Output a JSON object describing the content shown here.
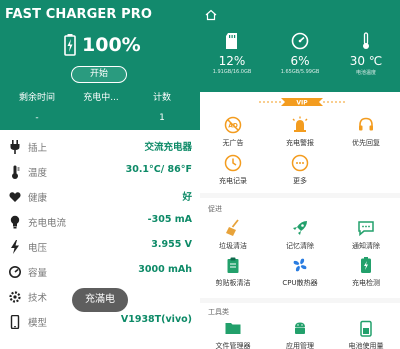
{
  "app_title": "FAST CHARGER PRO",
  "battery": {
    "percent_text": "100%",
    "start_label": "开始"
  },
  "stats": [
    {
      "label": "剩余时间",
      "value": "-"
    },
    {
      "label": "充电中...",
      "value": ""
    },
    {
      "label": "计数",
      "value": "1"
    }
  ],
  "info_rows": [
    {
      "icon": "plug-icon",
      "label": "插上",
      "value": "交流充电器"
    },
    {
      "icon": "thermometer-icon",
      "label": "温度",
      "value": "30.1°C/ 86°F"
    },
    {
      "icon": "heart-icon",
      "label": "健康",
      "value": "好"
    },
    {
      "icon": "bulb-icon",
      "label": "充电电流",
      "value": "-305 mA"
    },
    {
      "icon": "bolt-icon",
      "label": "电压",
      "value": "3.955 V"
    },
    {
      "icon": "gauge-icon",
      "label": "容量",
      "value": "3000 mAh"
    },
    {
      "icon": "gear-icon",
      "label": "技术",
      "value": ""
    },
    {
      "icon": "phone-icon",
      "label": "模型",
      "value": "V1938T(vivo)"
    }
  ],
  "toast": "充滿电",
  "right": {
    "top_icons": [
      "vip-icon",
      "more-icon",
      "home-icon"
    ],
    "vip_text": "VIP",
    "gauges": [
      {
        "icon": "sd-card-icon",
        "value": "12%",
        "sub": "1.91GB/16.0GB"
      },
      {
        "icon": "speedometer-icon",
        "value": "6%",
        "sub": "1.65GB/5.99GB"
      },
      {
        "icon": "thermometer-icon",
        "value": "30 ℃",
        "sub": "电池温度"
      }
    ],
    "vip_items": [
      {
        "icon": "no-ads-icon",
        "label": "无广告"
      },
      {
        "icon": "alarm-icon",
        "label": "充电警报"
      },
      {
        "icon": "headset-icon",
        "label": "优先回复"
      },
      {
        "icon": "record-icon",
        "label": "充电记录"
      },
      {
        "icon": "more-icon",
        "label": "更多"
      }
    ],
    "accelerate_title": "促进",
    "accelerate_items": [
      {
        "icon": "broom-icon",
        "label": "垃圾清洁"
      },
      {
        "icon": "rocket-icon",
        "label": "记忆清除"
      },
      {
        "icon": "message-icon",
        "label": "通知清除"
      },
      {
        "icon": "clipboard-icon",
        "label": "剪贴板清洁"
      },
      {
        "icon": "fan-icon",
        "label": "CPU散热器"
      },
      {
        "icon": "battery-check-icon",
        "label": "充电检测"
      }
    ],
    "tools_title": "工具类",
    "tools_items": [
      {
        "icon": "folder-icon",
        "label": "文件管理器"
      },
      {
        "icon": "android-icon",
        "label": "应用管理"
      },
      {
        "icon": "battery-usage-icon",
        "label": "电池使用量"
      }
    ]
  },
  "colors": {
    "primary": "#138a6d",
    "accent": "#f39c1f",
    "value": "#0d8a67"
  }
}
